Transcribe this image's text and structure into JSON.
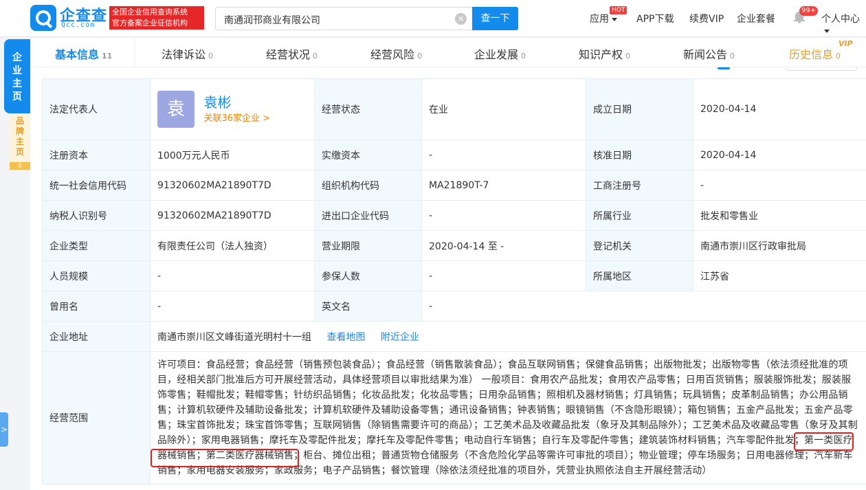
{
  "header": {
    "logo_text": "企查查",
    "logo_sub": "Qcc.com",
    "slogan_line1": "全国企业信用查询系统",
    "slogan_line2": "官方备案企业征信机构",
    "search_value": "南通润邗商业有限公司",
    "search_button": "查一下",
    "nav_apps": "应用",
    "hot_badge": "HOT",
    "nav_app_download": "APP下载",
    "nav_vip": "续费VIP",
    "nav_package": "企业套餐",
    "notice_badge": "99+",
    "nav_personal": "个人中心"
  },
  "side": {
    "main_tab": "企业主页",
    "brand_tab": "品牌主页",
    "brand_count": "0"
  },
  "tabs": [
    {
      "label": "基本信息",
      "count": "11"
    },
    {
      "label": "法律诉讼",
      "count": "0"
    },
    {
      "label": "经营状况",
      "count": "0"
    },
    {
      "label": "经营风险",
      "count": "0"
    },
    {
      "label": "企业发展",
      "count": "0"
    },
    {
      "label": "知识产权",
      "count": "0"
    },
    {
      "label": "新闻公告",
      "count": "0"
    },
    {
      "label": "历史信息",
      "count": "0"
    }
  ],
  "vip_tag": "VIP",
  "legal_rep": {
    "label": "法定代表人",
    "avatar_char": "袁",
    "name": "袁彬",
    "related": "关联36家企业 >"
  },
  "info": {
    "status_label": "经营状态",
    "status": "在业",
    "founded_label": "成立日期",
    "founded": "2020-04-14",
    "reg_capital_label": "注册资本",
    "reg_capital": "1000万元人民币",
    "paid_capital_label": "实缴资本",
    "paid_capital": "-",
    "approve_date_label": "核准日期",
    "approve_date": "2020-04-14",
    "credit_code_label": "统一社会信用代码",
    "credit_code": "91320602MA21890T7D",
    "org_code_label": "组织机构代码",
    "org_code": "MA21890T-7",
    "biz_reg_label": "工商注册号",
    "biz_reg": "-",
    "taxpayer_label": "纳税人识别号",
    "taxpayer": "91320602MA21890T7D",
    "import_export_label": "进出口企业代码",
    "import_export": "-",
    "industry_label": "所属行业",
    "industry": "批发和零售业",
    "company_type_label": "企业类型",
    "company_type": "有限责任公司（法人独资）",
    "term_label": "营业期限",
    "term": "2020-04-14 至 -",
    "authority_label": "登记机关",
    "authority": "南通市崇川区行政审批局",
    "staff_label": "人员规模",
    "staff": "-",
    "insured_label": "参保人数",
    "insured": "-",
    "region_label": "所属地区",
    "region": "江苏省",
    "former_name_label": "曾用名",
    "former_name": "-",
    "english_name_label": "英文名",
    "english_name": "-",
    "address_label": "企业地址",
    "address": "南通市崇川区文峰街道光明村十一组",
    "view_map": "查看地图",
    "nearby": "附近企业",
    "scope_label": "经营范围",
    "scope": "许可项目：食品经营；食品经营（销售预包装食品）；食品经营（销售散装食品）；食品互联网销售；保健食品销售；出版物批发；出版物零售（依法须经批准的项目，经相关部门批准后方可开展经营活动，具体经营项目以审批结果为准） 一般项目：食用农产品批发；食用农产品零售；日用百货销售；服装服饰批发；服装服饰零售；鞋帽批发；鞋帽零售；针纺织品销售；化妆品批发；化妆品零售；日用杂品销售；照相机及器材销售；灯具销售；玩具销售；皮革制品销售；办公用品销售；计算机软硬件及辅助设备批发；计算机软硬件及辅助设备零售；通讯设备销售；钟表销售；眼镜销售（不含隐形眼镜）；箱包销售；五金产品批发；五金产品零售；珠宝首饰批发；珠宝首饰零售；互联网销售（除销售需要许可的商品）；工艺美术品及收藏品批发（象牙及其制品除外）；工艺美术品及收藏品零售（象牙及其制品除外）；家用电器销售；摩托车及零配件批发；摩托车及零配件零售；电动自行车销售；自行车及零配件零售；建筑装饰材料销售；汽车零配件批发；第一类医疗器械销售；第二类医疗器械销售；柜台、摊位出租；普通货物仓储服务（不含危险化学品等需许可审批的项目）；物业管理；停车场服务；日用电器修理；汽车新车销售；家用电器安装服务；家政服务；电子产品销售；餐饮管理（除依法须经批准的项目外，凭营业执照依法自主开展经营活动）"
  }
}
